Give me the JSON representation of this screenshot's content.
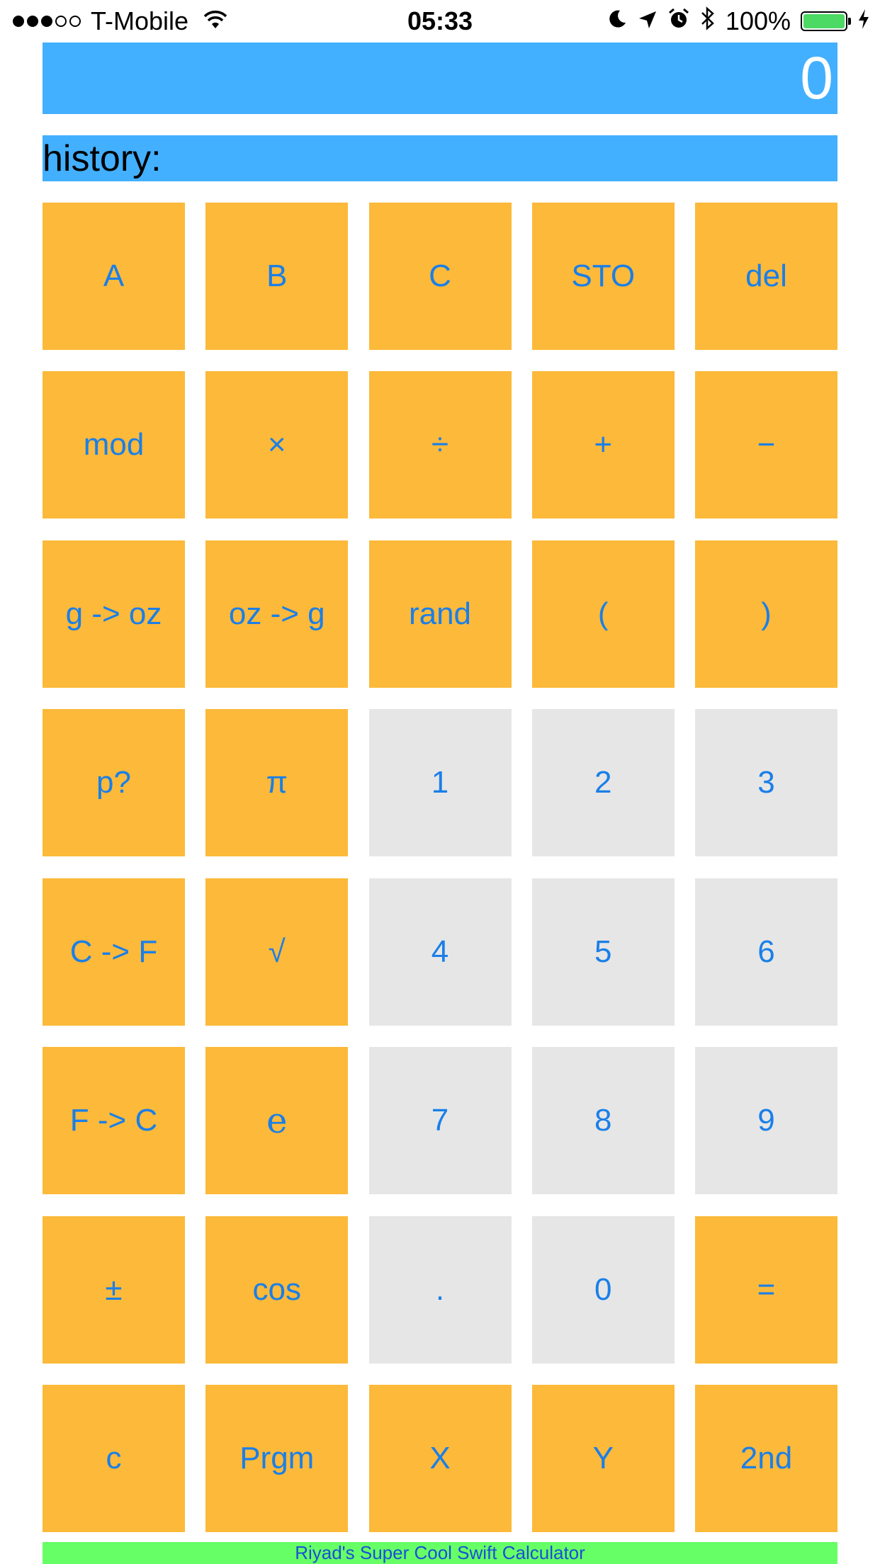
{
  "colors": {
    "display_bg": "#43B0FF",
    "history_bg": "#43B0FF",
    "operator_key_bg": "#FCB93A",
    "digit_key_bg": "#E6E6E6",
    "key_text": "#1A7FE8",
    "footer_bg": "#66FF66",
    "footer_text": "#1A4FD8",
    "battery_fill": "#4CD964"
  },
  "status_bar": {
    "carrier": "T-Mobile",
    "time": "05:33",
    "battery_percent": "100%",
    "signal_bars_filled": 3,
    "signal_bars_total": 5,
    "battery_level": 1.0,
    "icons": [
      "wifi-icon",
      "moon-icon",
      "location-arrow-icon",
      "alarm-icon",
      "bluetooth-icon",
      "battery-icon",
      "charging-bolt-icon"
    ]
  },
  "display": {
    "value": "0"
  },
  "history": {
    "label": "history:"
  },
  "keys": [
    {
      "label": "A",
      "kind": "operator"
    },
    {
      "label": "B",
      "kind": "operator"
    },
    {
      "label": "C",
      "kind": "operator"
    },
    {
      "label": "STO",
      "kind": "operator"
    },
    {
      "label": "del",
      "kind": "operator"
    },
    {
      "label": "mod",
      "kind": "operator"
    },
    {
      "label": "×",
      "kind": "operator"
    },
    {
      "label": "÷",
      "kind": "operator"
    },
    {
      "label": "+",
      "kind": "operator"
    },
    {
      "label": "−",
      "kind": "operator"
    },
    {
      "label": "g -> oz",
      "kind": "operator"
    },
    {
      "label": "oz -> g",
      "kind": "operator"
    },
    {
      "label": "rand",
      "kind": "operator"
    },
    {
      "label": "(",
      "kind": "operator"
    },
    {
      "label": ")",
      "kind": "operator"
    },
    {
      "label": "p?",
      "kind": "operator"
    },
    {
      "label": "π",
      "kind": "operator"
    },
    {
      "label": "1",
      "kind": "digit"
    },
    {
      "label": "2",
      "kind": "digit"
    },
    {
      "label": "3",
      "kind": "digit"
    },
    {
      "label": "C -> F",
      "kind": "operator"
    },
    {
      "label": "√",
      "kind": "operator"
    },
    {
      "label": "4",
      "kind": "digit"
    },
    {
      "label": "5",
      "kind": "digit"
    },
    {
      "label": "6",
      "kind": "digit"
    },
    {
      "label": "F -> C",
      "kind": "operator"
    },
    {
      "label": "e",
      "kind": "operator"
    },
    {
      "label": "7",
      "kind": "digit"
    },
    {
      "label": "8",
      "kind": "digit"
    },
    {
      "label": "9",
      "kind": "digit"
    },
    {
      "label": "±",
      "kind": "operator"
    },
    {
      "label": "cos",
      "kind": "operator"
    },
    {
      "label": ".",
      "kind": "digit"
    },
    {
      "label": "0",
      "kind": "digit"
    },
    {
      "label": "=",
      "kind": "operator"
    },
    {
      "label": "c",
      "kind": "operator"
    },
    {
      "label": "Prgm",
      "kind": "operator"
    },
    {
      "label": "X",
      "kind": "operator"
    },
    {
      "label": "Y",
      "kind": "operator"
    },
    {
      "label": "2nd",
      "kind": "operator"
    }
  ],
  "footer": {
    "text": "Riyad's Super Cool Swift Calculator"
  }
}
